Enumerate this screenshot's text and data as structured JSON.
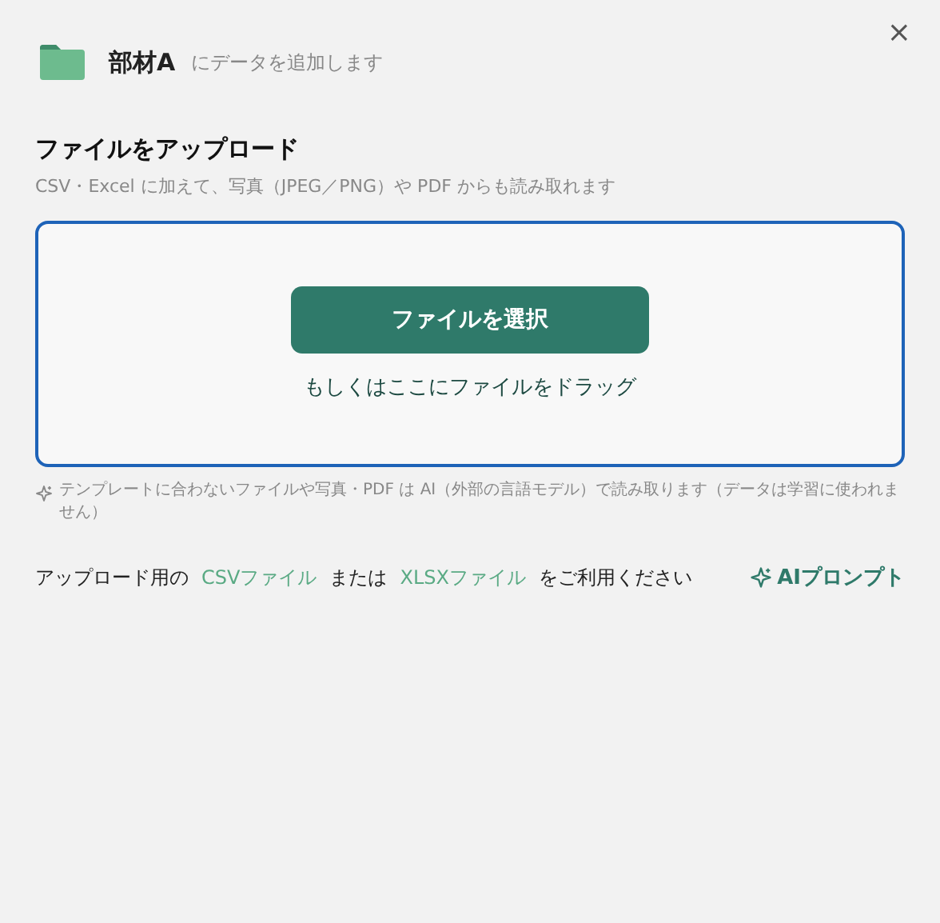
{
  "header": {
    "folder_name": "部材A",
    "caption": "にデータを追加します",
    "close": "×"
  },
  "upload": {
    "title": "ファイルをアップロード",
    "subtitle": "CSV・Excel に加えて、写真（JPEG／PNG）や PDF からも読み取れます",
    "button": "ファイルを選択",
    "drop_hint": "もしくはここにファイルをドラッグ"
  },
  "ai_note": "テンプレートに合わないファイルや写真・PDF は AI（外部の言語モデル）で読み取ります（データは学習に使われません）",
  "footer": {
    "segments": [
      {
        "kind": "text",
        "text": "アップロード用の"
      },
      {
        "kind": "link",
        "text": "CSVファイル"
      },
      {
        "kind": "text",
        "text": "または"
      },
      {
        "kind": "link",
        "text": "XLSXファイル"
      },
      {
        "kind": "text",
        "text": "をご利用ください"
      }
    ],
    "ai_prompt": "AIプロンプト"
  }
}
